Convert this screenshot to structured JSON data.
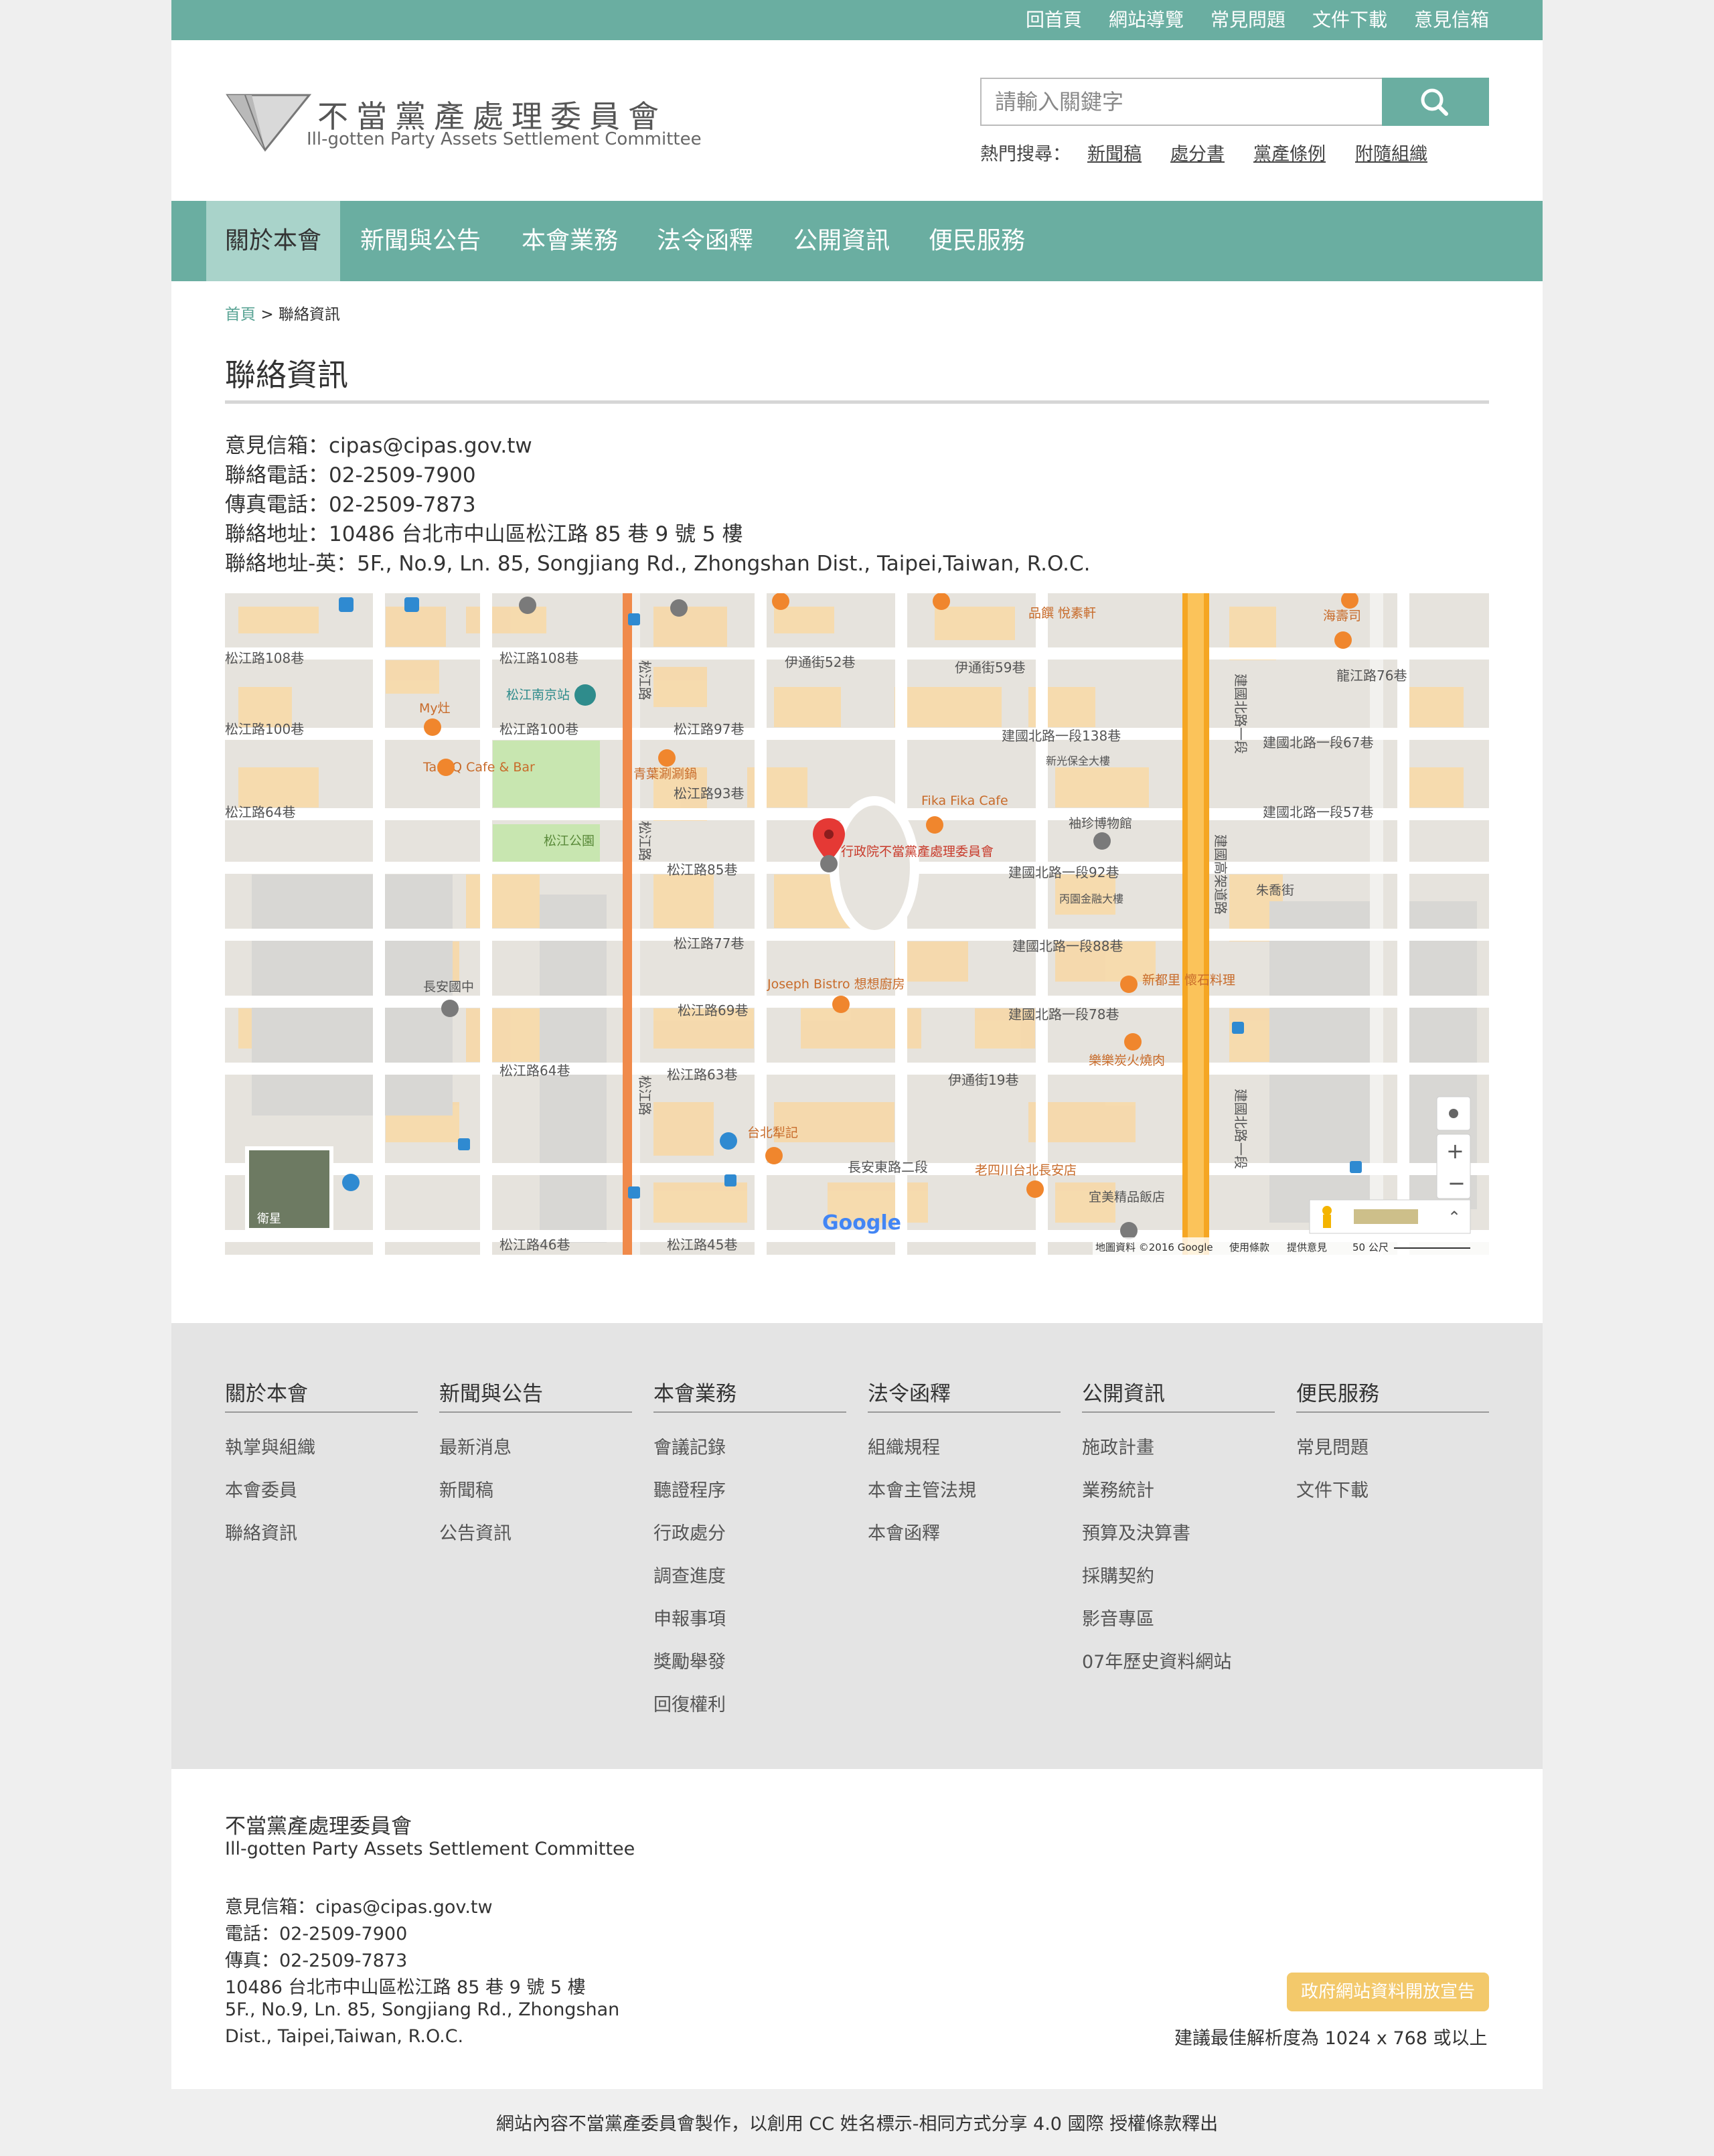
{
  "topbar": {
    "links": [
      "回首頁",
      "網站導覽",
      "常見問題",
      "文件下載",
      "意見信箱"
    ]
  },
  "header": {
    "logo_cn": "不當黨產處理委員會",
    "logo_en": "Ill-gotten Party Assets Settlement Committee",
    "search": {
      "placeholder": "請輸入關鍵字"
    },
    "hot_label": "熱門搜尋：",
    "hot_links": [
      "新聞稿",
      "處分書",
      "黨產條例",
      "附隨組織"
    ]
  },
  "nav": {
    "items": [
      "關於本會",
      "新聞與公告",
      "本會業務",
      "法令函釋",
      "公開資訊",
      "便民服務"
    ],
    "active": "關於本會"
  },
  "breadcrumb": {
    "home": "首頁",
    "sep": ">",
    "current": "聯絡資訊"
  },
  "page_title": "聯絡資訊",
  "contact": {
    "lines": [
      "意見信箱：cipas@cipas.gov.tw",
      "聯絡電話：02-2509-7900",
      "傳真電話：02-2509-7873",
      "聯絡地址：10486 台北市中山區松江路 85 巷 9 號 5 樓",
      "聯絡地址-英：5F., No.9, Ln. 85, Songjiang Rd., Zhongshan Dist., Taipei,Taiwan, R.O.C."
    ]
  },
  "map": {
    "streets": {
      "songjiang_road": "松江路",
      "jianguo_north": "建國北路一段",
      "jianguo_elevated": "建國高架道路",
      "changan_east": "長安東路二段",
      "lane_108": "松江路108巷",
      "lane_100": "松江路100巷",
      "lane_97": "松江路97巷",
      "lane_93": "松江路93巷",
      "lane_85": "松江路85巷",
      "lane_77": "松江路77巷",
      "lane_69": "松江路69巷",
      "lane_64": "松江路64巷",
      "lane_63": "松江路63巷",
      "lane_46": "松江路46巷",
      "lane_45": "松江路45巷",
      "yitong_52": "伊通街52巷",
      "yitong_59": "伊通街59巷",
      "yitong_19": "伊通街19巷",
      "jg_138": "建國北路一段138巷",
      "jg_92": "建國北路一段92巷",
      "jg_88": "建國北路一段88巷",
      "jg_78": "建國北路一段78巷",
      "jg_67": "建國北路一段67巷",
      "jg_57": "建國北路一段57巷",
      "longjiang_76": "龍江路76巷"
    },
    "places": {
      "target": "行政院不當黨產處理委員會",
      "park": "松江公園",
      "station": "松江南京站",
      "myzao": "My灶",
      "tankq": "TankQ Cafe & Bar",
      "hotpot": "青葉涮涮鍋",
      "fika": "Fika Fika Cafe",
      "jujin": "袖珍博物館",
      "joseph": "Joseph Bistro 想想廚房",
      "xindu": "新都里 懷石料理",
      "yakiniku": "樂樂炭火燒肉",
      "changan_school": "長安國中",
      "taibei_liji": "台北犁記",
      "laosichuan": "老四川台北長安店",
      "yimei": "宜美精品飯店",
      "xinguang": "新光保全大樓",
      "bingyuan": "丙園金融大樓",
      "pinfu": "品饌 悅素軒",
      "haishi": "海壽司",
      "zhujun": "朱喬街"
    },
    "google_logo": "Google",
    "satellite_label": "衛星",
    "attribution": "地圖資料 ©2016 Google",
    "terms": "使用條款",
    "feedback": "提供意見",
    "scale": "50 公尺"
  },
  "sitemap": [
    {
      "title": "關於本會",
      "links": [
        "執掌與組織",
        "本會委員",
        "聯絡資訊"
      ]
    },
    {
      "title": "新聞與公告",
      "links": [
        "最新消息",
        "新聞稿",
        "公告資訊"
      ]
    },
    {
      "title": "本會業務",
      "links": [
        "會議記錄",
        "聽證程序",
        "行政處分",
        "調查進度",
        "申報事項",
        "獎勵舉發",
        "回復權利"
      ]
    },
    {
      "title": "法令函釋",
      "links": [
        "組織規程",
        "本會主管法規",
        "本會函釋"
      ]
    },
    {
      "title": "公開資訊",
      "links": [
        "施政計畫",
        "業務統計",
        "預算及決算書",
        "採購契約",
        "影音專區",
        "07年歷史資料網站"
      ]
    },
    {
      "title": "便民服務",
      "links": [
        "常見問題",
        "文件下載"
      ]
    }
  ],
  "footer": {
    "org_cn": "不當黨產處理委員會",
    "org_en": "Ill-gotten Party Assets Settlement Committee",
    "email": "意見信箱：cipas@cipas.gov.tw",
    "phone": "電話：02-2509-7900",
    "fax": "傳真：02-2509-7873",
    "addr_cn": "10486 台北市中山區松江路 85 巷 9 號 5 樓",
    "addr_en_1": "5F., No.9, Ln. 85, Songjiang Rd., Zhongshan",
    "addr_en_2": "Dist., Taipei,Taiwan, R.O.C.",
    "badge": "政府網站資料開放宣告",
    "resolution": "建議最佳解析度為 1024 x 768 或以上",
    "license": "網站內容不當黨產委員會製作，以創用 CC 姓名標示-相同方式分享 4.0 國際 授權條款釋出"
  },
  "colors": {
    "brand": "#6aaea1",
    "nav_active": "#a9d3ca",
    "badge": "#f3c96b",
    "map_road_major": "#f5a623",
    "pin": "#e53935"
  }
}
